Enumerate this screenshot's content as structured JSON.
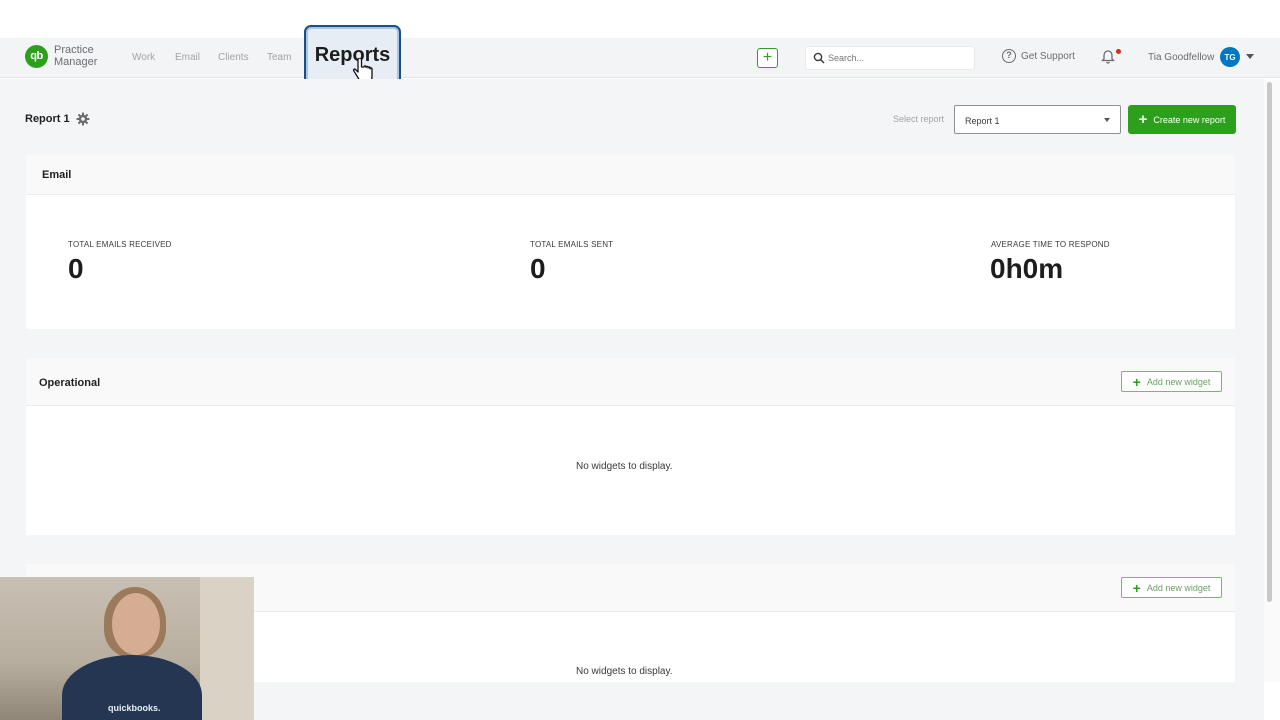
{
  "app": {
    "logo_mark": "qb",
    "logo_line1": "Practice",
    "logo_line2": "Manager"
  },
  "nav": {
    "items": [
      {
        "label": "Work"
      },
      {
        "label": "Email"
      },
      {
        "label": "Clients"
      },
      {
        "label": "Team"
      },
      {
        "label": "Reports",
        "active": true
      }
    ],
    "add_icon": "plus-icon",
    "search_placeholder": "Search...",
    "support_label": "Get Support",
    "user_name": "Tia Goodfellow",
    "user_initials": "TG",
    "notification_dot_color": "#d52b1e"
  },
  "toolbar": {
    "report_title": "Report 1",
    "select_label": "Select report",
    "selected_report": "Report 1",
    "create_button": "Create new report"
  },
  "email_card": {
    "title": "Email",
    "metrics": [
      {
        "label": "TOTAL EMAILS RECEIVED",
        "value": "0"
      },
      {
        "label": "TOTAL EMAILS SENT",
        "value": "0"
      },
      {
        "label": "AVERAGE TIME TO RESPOND",
        "value": "0h0m"
      }
    ]
  },
  "operational_card": {
    "title": "Operational",
    "add_widget": "Add new widget",
    "empty_message": "No widgets to display."
  },
  "third_card": {
    "add_widget": "Add new widget",
    "empty_message": "No widgets to display."
  },
  "webcam": {
    "shirt_text": "quickbooks."
  },
  "colors": {
    "brand_green": "#2ca01c",
    "avatar_blue": "#0077c5",
    "highlight_border": "#1a4f86"
  }
}
